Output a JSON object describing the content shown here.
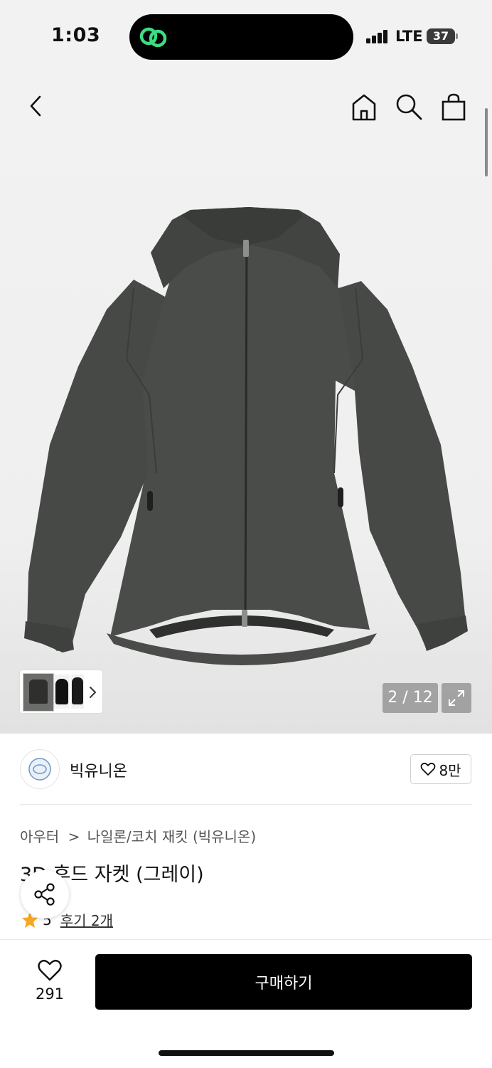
{
  "status_bar": {
    "time": "1:03",
    "network": "LTE",
    "battery": "37",
    "island_icon": "link-icon"
  },
  "header": {
    "back_icon": "back-arrow-icon",
    "home_icon": "home-icon",
    "search_icon": "search-icon",
    "cart_icon": "shopping-bag-icon"
  },
  "gallery": {
    "counter": "2 / 12",
    "thumbnail_more_icon": "chevron-right-icon",
    "fullscreen_icon": "expand-icon",
    "jacket_color": "#4a4c49"
  },
  "brand": {
    "name": "빅유니온",
    "like_count": "8만"
  },
  "product": {
    "breadcrumb_category": "아우터",
    "breadcrumb_separator": ">",
    "breadcrumb_sub": "나일론/코치 재킷 (빅유니온)",
    "title": "3D 후드 자켓 (그레이)",
    "rating": "5",
    "reviews": "후기 2개"
  },
  "bottom_bar": {
    "wish_count": "291",
    "buy_label": "구매하기"
  },
  "colors": {
    "star": "#f5a623",
    "buy_button": "#000000"
  }
}
